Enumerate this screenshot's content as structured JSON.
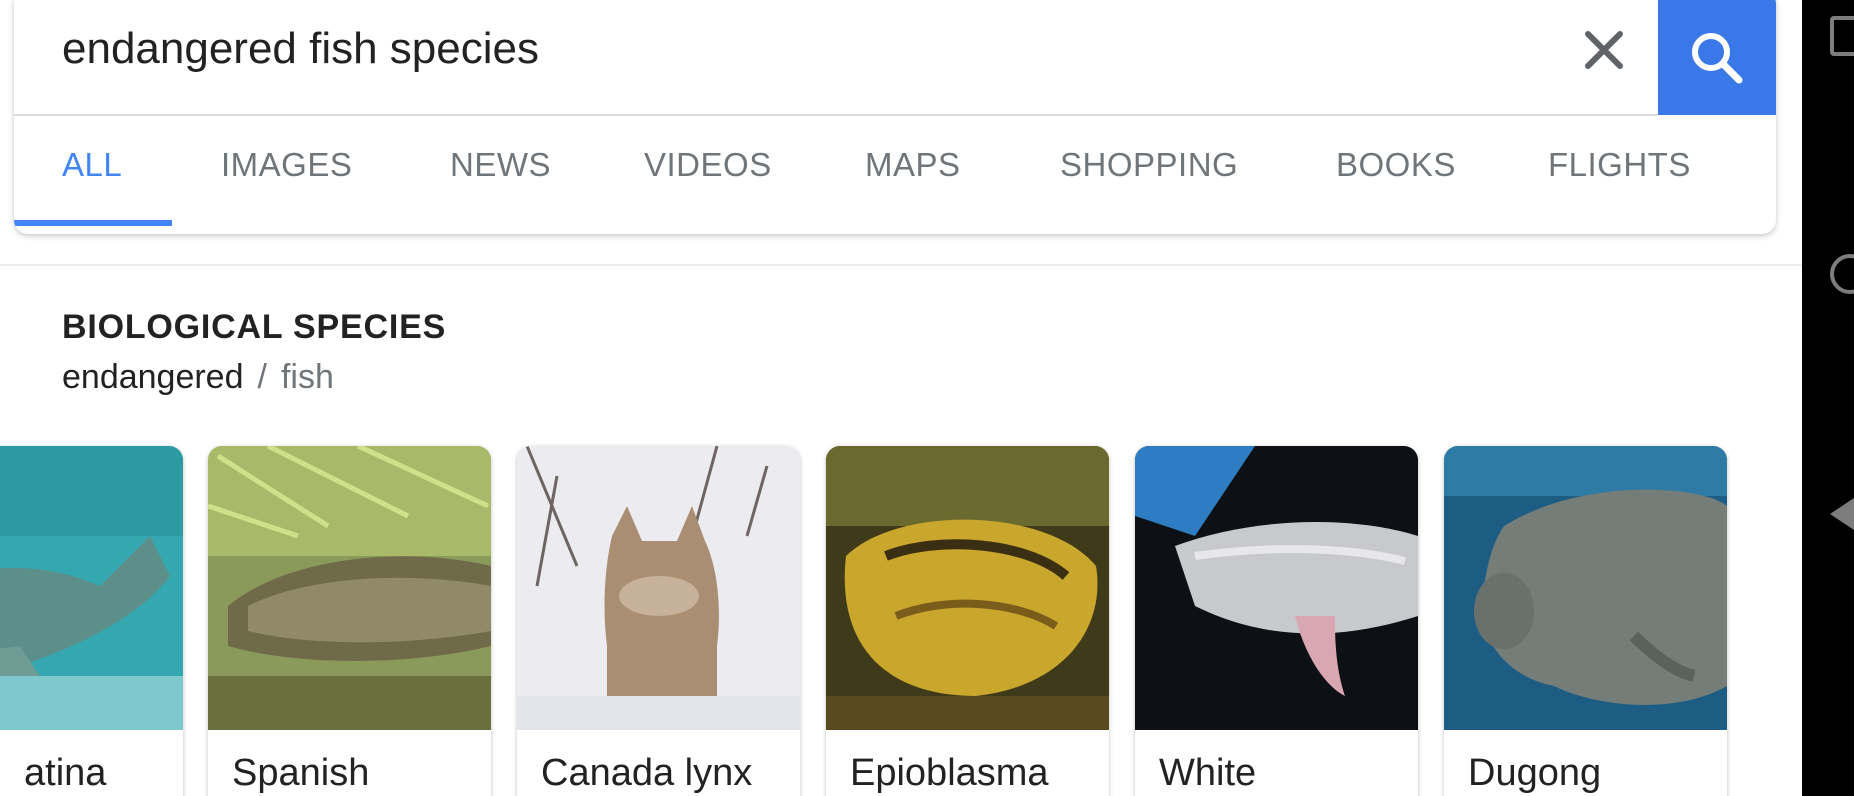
{
  "search": {
    "query": "endangered fish species"
  },
  "tabs": [
    {
      "label": "ALL",
      "active": true
    },
    {
      "label": "IMAGES"
    },
    {
      "label": "NEWS"
    },
    {
      "label": "VIDEOS"
    },
    {
      "label": "MAPS"
    },
    {
      "label": "SHOPPING"
    },
    {
      "label": "BOOKS"
    },
    {
      "label": "FLIGHTS"
    }
  ],
  "section": {
    "heading": "BIOLOGICAL SPECIES",
    "breadcrumb": [
      "endangered",
      "fish"
    ],
    "separator": "/"
  },
  "species_cards": [
    {
      "label": "atina"
    },
    {
      "label": "Spanish"
    },
    {
      "label": "Canada lynx"
    },
    {
      "label": "Epioblasma"
    },
    {
      "label": "White"
    },
    {
      "label": "Dugong"
    }
  ],
  "icons": {
    "clear": "close-icon",
    "search": "search-icon",
    "nav": [
      "recents-icon",
      "home-icon",
      "back-icon"
    ]
  },
  "colors": {
    "accent": "#4285f4",
    "search_button": "#3b78e7",
    "tab_text": "#70757a"
  }
}
